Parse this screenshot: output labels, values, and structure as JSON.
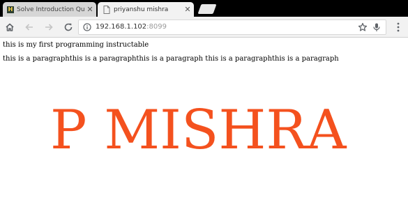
{
  "tabs": [
    {
      "title": "Solve Introduction Questio",
      "favicon": "site-favicon",
      "favicon_glyph": "H",
      "active": false
    },
    {
      "title": "priyanshu mishra",
      "favicon": "document-icon",
      "active": true
    }
  ],
  "tab_close_glyph": "✕",
  "toolbar": {
    "url_host": "192.168.1.102",
    "url_port": ":8099"
  },
  "page": {
    "heading": "this is my first programming instructable",
    "paragraph": "this is a paragraphthis is a paragraphthis is a paragraph this is a paragraphthis is a paragraph",
    "big_name": "P MISHRA",
    "big_name_color": "#f4511e"
  },
  "colors": {
    "tabstrip": "#000000",
    "toolbar": "#f2f2f2",
    "icon": "#5f6368"
  }
}
